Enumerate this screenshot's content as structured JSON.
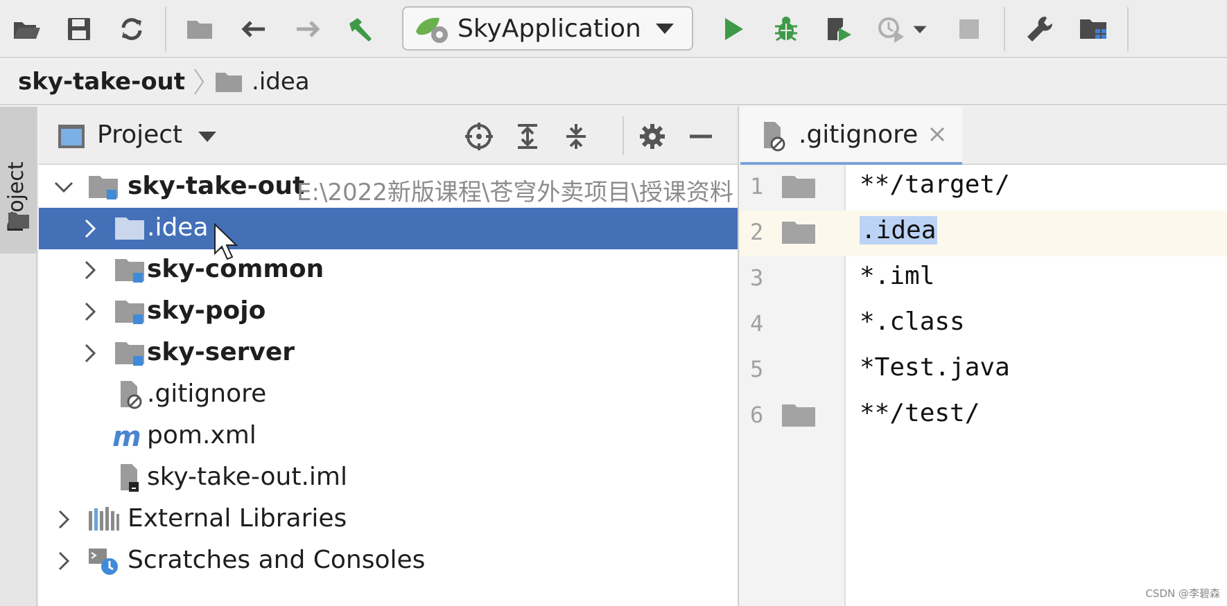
{
  "toolbar": {
    "buttons": [
      "open-folder-icon",
      "save-icon",
      "sync-icon",
      "folder-icon",
      "back-arrow-icon",
      "forward-arrow-icon",
      "build-hammer-icon"
    ],
    "run_config_label": "SkyApplication",
    "run_buttons": [
      "run-icon",
      "debug-icon",
      "coverage-icon",
      "profile-icon",
      "stop-icon",
      "settings-wrench-icon",
      "project-structure-icon"
    ]
  },
  "breadcrumb": {
    "project": "sky-take-out",
    "item": ".idea"
  },
  "toolstrip": {
    "tab_label": "Project"
  },
  "project_panel": {
    "title": "Project",
    "tools": [
      "locate-icon",
      "expand-all-icon",
      "collapse-all-icon",
      "gear-icon",
      "hide-icon"
    ]
  },
  "tree": {
    "root": {
      "label": "sky-take-out",
      "path": "E:\\2022新版课程\\苍穹外卖项目\\授课资料"
    },
    "items": [
      {
        "label": ".idea",
        "type": "folder",
        "bold": false,
        "selected": true
      },
      {
        "label": "sky-common",
        "type": "module",
        "bold": true
      },
      {
        "label": "sky-pojo",
        "type": "module",
        "bold": true
      },
      {
        "label": "sky-server",
        "type": "module",
        "bold": true
      },
      {
        "label": ".gitignore",
        "type": "ignore-file",
        "bold": false
      },
      {
        "label": "pom.xml",
        "type": "maven-file",
        "bold": false
      },
      {
        "label": "sky-take-out.iml",
        "type": "iml-file",
        "bold": false
      }
    ],
    "external_libraries": "External Libraries",
    "scratches": "Scratches and Consoles"
  },
  "editor": {
    "tab_label": ".gitignore",
    "lines": [
      {
        "num": "1",
        "text": "**/target/",
        "folder": true
      },
      {
        "num": "2",
        "text": ".idea",
        "folder": true,
        "current": true,
        "highlight": true
      },
      {
        "num": "3",
        "text": "*.iml",
        "folder": false
      },
      {
        "num": "4",
        "text": "*.class",
        "folder": false
      },
      {
        "num": "5",
        "text": "*Test.java",
        "folder": false
      },
      {
        "num": "6",
        "text": "**/test/",
        "folder": true
      }
    ]
  },
  "watermark": "CSDN @李碧森",
  "colors": {
    "selection": "#4470b8",
    "text_highlight": "#bcd3f5",
    "current_line": "#fdf8ec",
    "run_green": "#3e9a48"
  }
}
